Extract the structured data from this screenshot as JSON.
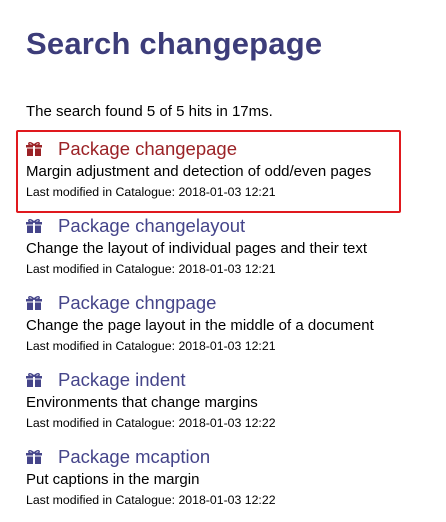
{
  "page": {
    "title": "Search changepage",
    "summary": "The search found 5 of 5 hits in 17ms."
  },
  "colors": {
    "title": "#3d3d7a",
    "link": "#45458a",
    "active_link": "#9b2226",
    "highlight_border": "#e0191e"
  },
  "results": [
    {
      "icon": "package-icon",
      "title": "Package changepage",
      "description": "Margin adjustment and detection of odd/even pages",
      "modified": "Last modified in Catalogue: 2018-01-03 12:21"
    },
    {
      "icon": "package-icon",
      "title": "Package changelayout",
      "description": "Change the layout of individual pages and their text",
      "modified": "Last modified in Catalogue: 2018-01-03 12:21"
    },
    {
      "icon": "package-icon",
      "title": "Package chngpage",
      "description": "Change the page layout in the middle of a document",
      "modified": "Last modified in Catalogue: 2018-01-03 12:21"
    },
    {
      "icon": "package-icon",
      "title": "Package indent",
      "description": "Environments that change margins",
      "modified": "Last modified in Catalogue: 2018-01-03 12:22"
    },
    {
      "icon": "package-icon",
      "title": "Package mcaption",
      "description": "Put captions in the margin",
      "modified": "Last modified in Catalogue: 2018-01-03 12:22"
    }
  ]
}
